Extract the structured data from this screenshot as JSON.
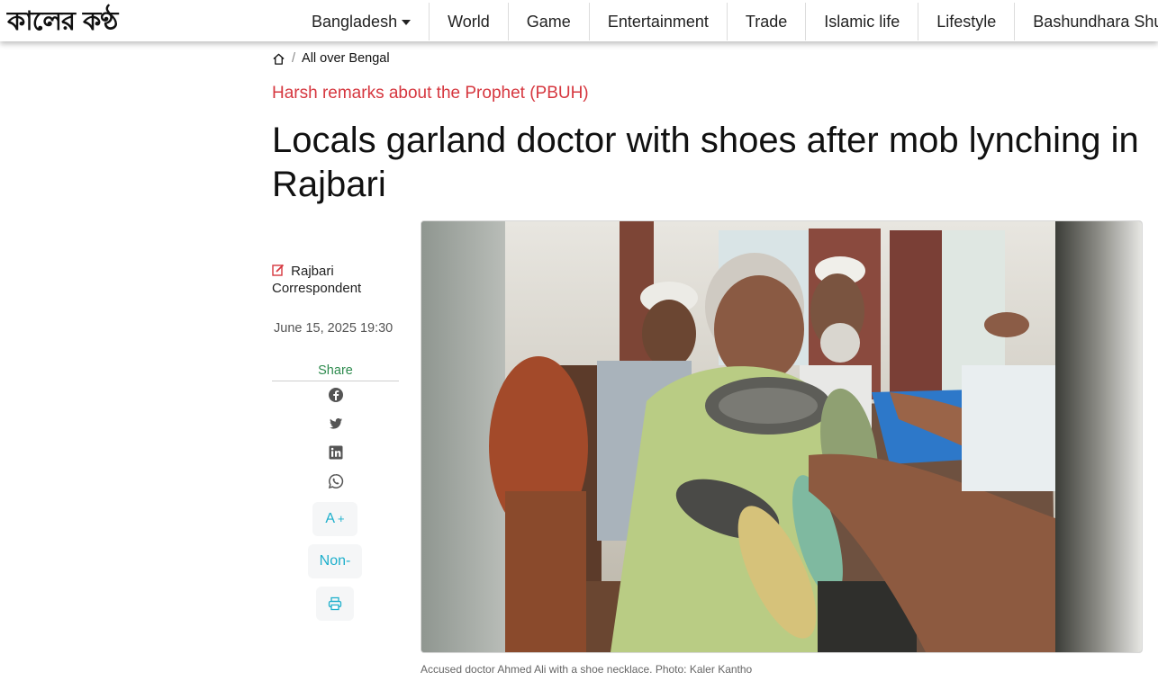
{
  "site": {
    "logo_text": "কালের কণ্ঠ"
  },
  "nav": {
    "items": [
      "Bangladesh",
      "World",
      "Game",
      "Entertainment",
      "Trade",
      "Islamic life",
      "Lifestyle",
      "Bashundhara Shuvosangho"
    ]
  },
  "breadcrumb": {
    "home_icon": "home-icon",
    "section": "All over Bengal"
  },
  "article": {
    "kicker": "Harsh remarks about the Prophet (PBUH)",
    "headline": "Locals garland doctor with shoes after mob lynching in Rajbari",
    "byline": "Rajbari Correspondent",
    "date": "June 15, 2025 19:30",
    "caption": "Accused doctor Ahmed Ali with a shoe necklace. Photo: Kaler Kantho"
  },
  "share": {
    "label": "Share",
    "icons": [
      "facebook-icon",
      "twitter-icon",
      "linkedin-icon",
      "whatsapp-icon"
    ]
  },
  "tools": {
    "font_increase": "A",
    "font_increase_suffix": "+",
    "non_label": "Non-",
    "print_icon": "printer-icon"
  },
  "colors": {
    "kicker": "#d6373f",
    "share": "#2e8b4e",
    "tool_accent": "#1fb0cc"
  }
}
